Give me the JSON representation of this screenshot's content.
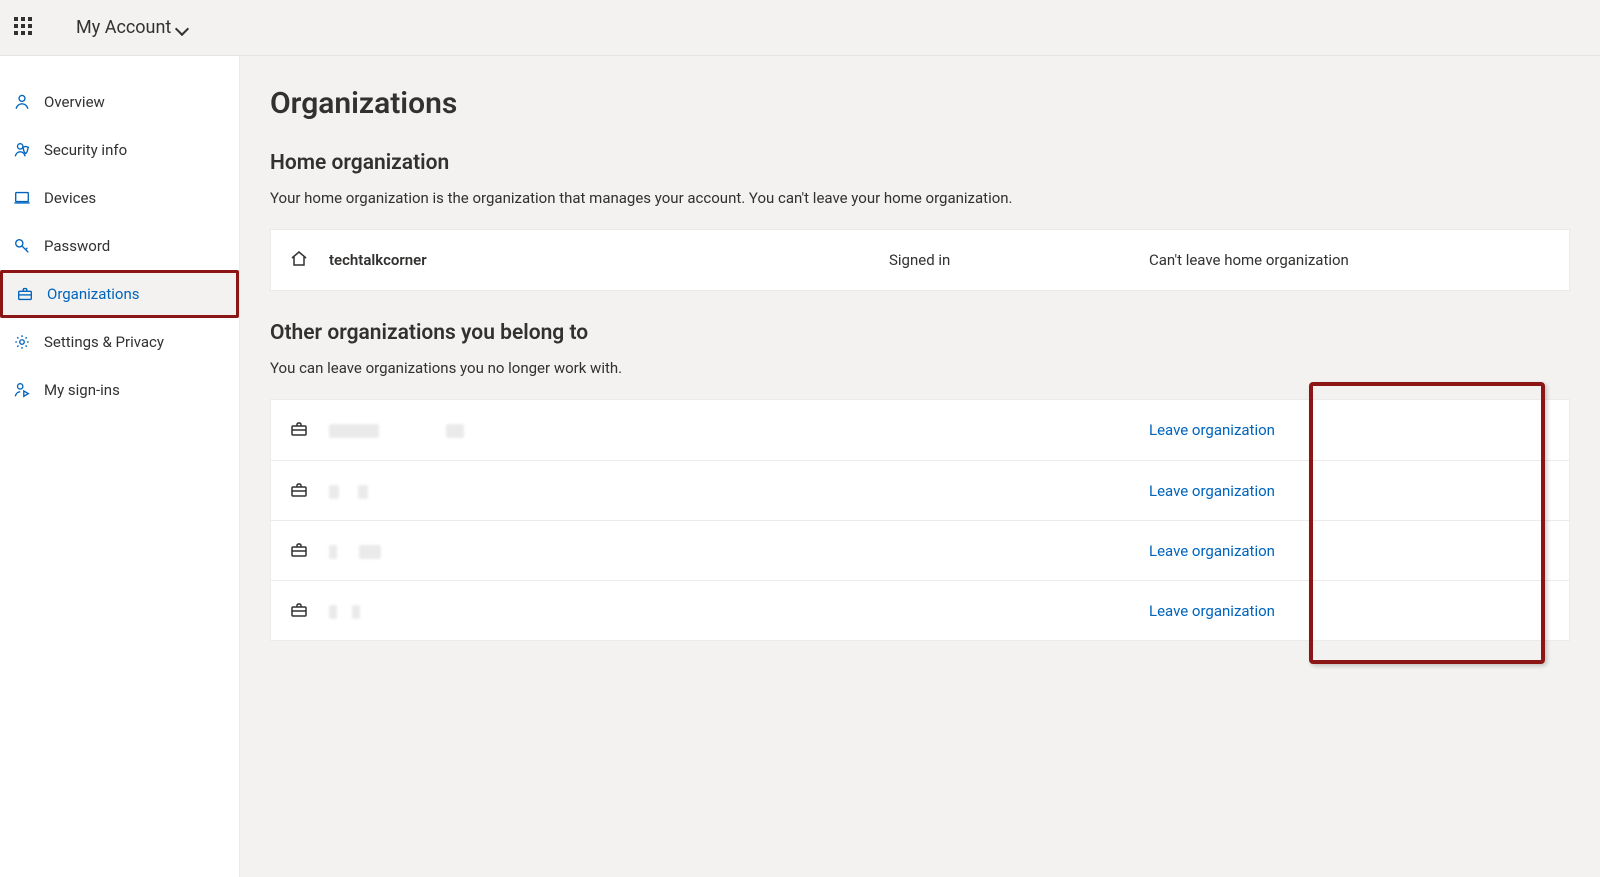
{
  "header": {
    "account_label": "My Account"
  },
  "sidebar": {
    "items": [
      {
        "label": "Overview",
        "icon": "person"
      },
      {
        "label": "Security info",
        "icon": "security"
      },
      {
        "label": "Devices",
        "icon": "device"
      },
      {
        "label": "Password",
        "icon": "key"
      },
      {
        "label": "Organizations",
        "icon": "briefcase",
        "active": true
      },
      {
        "label": "Settings & Privacy",
        "icon": "gear"
      },
      {
        "label": "My sign-ins",
        "icon": "signins"
      }
    ]
  },
  "page": {
    "title": "Organizations",
    "home_section": {
      "title": "Home organization",
      "desc": "Your home organization is the organization that manages your account. You can't leave your home organization.",
      "org_name": "techtalkcorner",
      "status": "Signed in",
      "action": "Can't leave home organization"
    },
    "other_section": {
      "title": "Other organizations you belong to",
      "desc": "You can leave organizations you no longer work with.",
      "leave_label": "Leave organization",
      "rows": [
        {
          "name_redacted": true
        },
        {
          "name_redacted": true
        },
        {
          "name_redacted": true
        },
        {
          "name_redacted": true
        }
      ]
    }
  }
}
